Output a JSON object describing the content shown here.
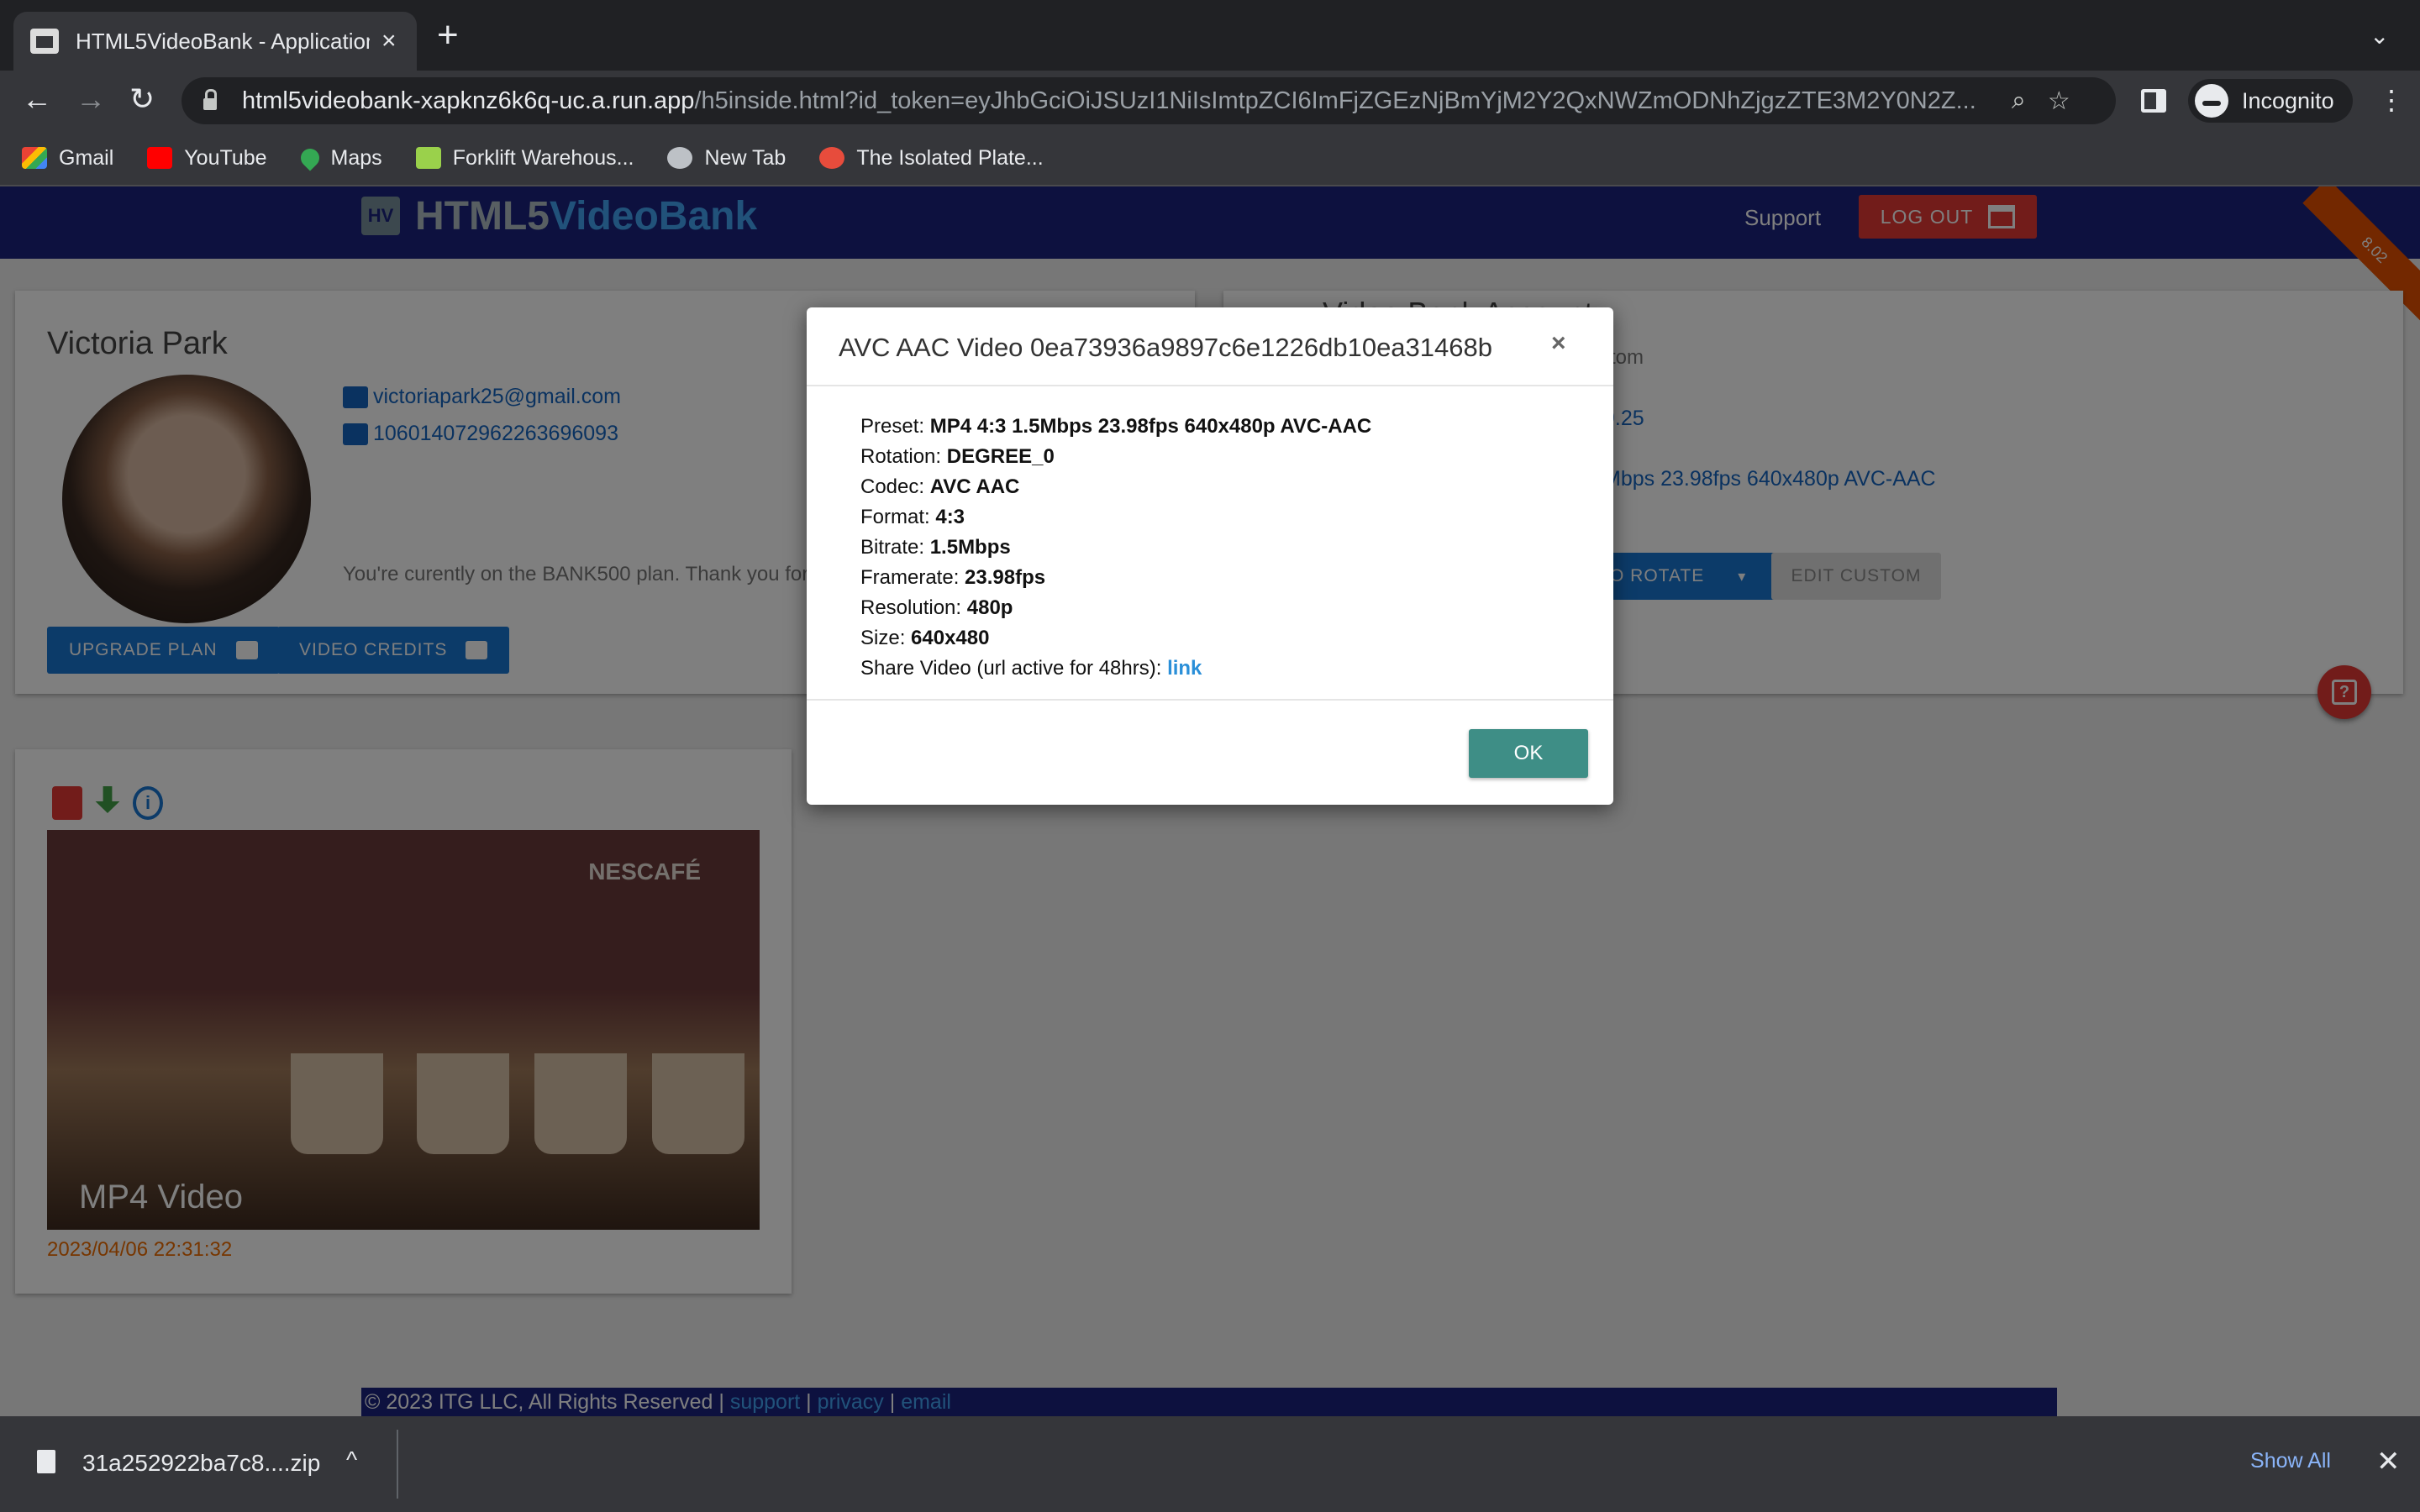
{
  "browser": {
    "tab_title": "HTML5VideoBank - Application",
    "tab_close": "×",
    "new_tab": "+",
    "url_host": "html5videobank-xapknz6k6q-uc.a.run.app",
    "url_path": "/h5inside.html?id_token=eyJhbGciOiJSUzI1NiIsImtpZCI6ImFjZGEzNjBmYjM2Y2QxNWZmODNhZjgzZTE3M2Y0N2Z...",
    "incognito_label": "Incognito",
    "bookmarks": [
      "Gmail",
      "YouTube",
      "Maps",
      "Forklift Warehous...",
      "New Tab",
      "The Isolated Plate..."
    ]
  },
  "app": {
    "logo_part1": "HTML5",
    "logo_part2": "VideoBank",
    "logo_mark": "HV",
    "support": "Support",
    "logout": "LOG OUT",
    "version": "8.02"
  },
  "profile": {
    "name": "Victoria Park",
    "email": "victoriapark25@gmail.com",
    "user_id": "106014072962263696093",
    "plan_text": "You're curently on the BANK500 plan. Thank you for using our app.",
    "upgrade_label": "UPGRADE PLAN",
    "credits_label": "VIDEO CREDITS"
  },
  "account": {
    "title": "Video Bank Account",
    "sub": "tom",
    "balance_fragment": "9.25",
    "preset_fragment": "Mbps 23.98fps 640x480p AVC-AAC",
    "rotate_label": "O ROTATE",
    "rotate_caret": "▾",
    "edit_custom_label": "EDIT CUSTOM"
  },
  "help_icon": "?",
  "video": {
    "brand": "NESCAFÉ",
    "label": "MP4 Video",
    "date": "2023/04/06 22:31:32",
    "info_icon": "i"
  },
  "footer": {
    "copyright": "© 2023 ITG LLC, All Rights Reserved | ",
    "support": "support",
    "sep1": " | ",
    "privacy": "privacy",
    "sep2": " | ",
    "email": "email"
  },
  "modal": {
    "title": "AVC AAC Video 0ea73936a9897c6e1226db10ea31468b",
    "close": "×",
    "fields": [
      {
        "label": "Preset: ",
        "value": "MP4 4:3 1.5Mbps 23.98fps 640x480p AVC-AAC"
      },
      {
        "label": "Rotation: ",
        "value": "DEGREE_0"
      },
      {
        "label": "Codec: ",
        "value": "AVC AAC"
      },
      {
        "label": "Format: ",
        "value": "4:3"
      },
      {
        "label": "Bitrate: ",
        "value": "1.5Mbps"
      },
      {
        "label": "Framerate: ",
        "value": "23.98fps"
      },
      {
        "label": "Resolution: ",
        "value": "480p"
      },
      {
        "label": "Size: ",
        "value": "640x480"
      }
    ],
    "share_label": "Share Video (url active for 48hrs): ",
    "share_link": "link",
    "ok": "OK"
  },
  "downloads": {
    "file": "31a252922ba7c8....zip",
    "caret": "^",
    "show_all": "Show All",
    "close": "✕"
  }
}
